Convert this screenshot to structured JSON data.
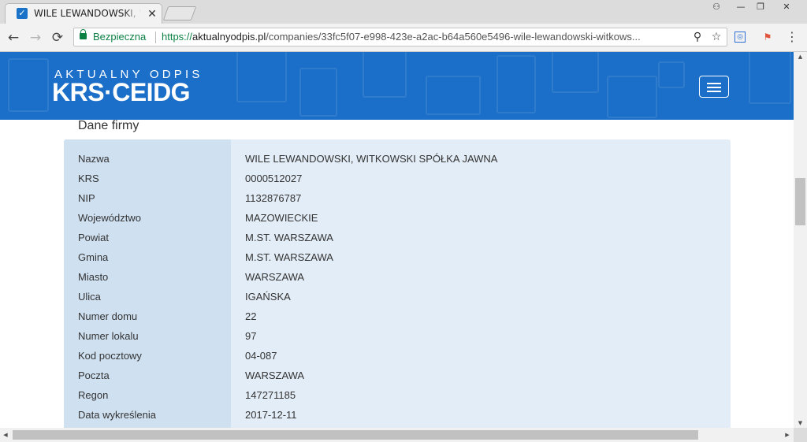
{
  "browser": {
    "tab": {
      "title": "WILE LEWANDOWSKI, WITKOWSKI SPÓŁKA JAWNA",
      "favicon": "check-icon",
      "close_glyph": "✕"
    },
    "window_controls": {
      "profile_glyph": "⚇",
      "minimize_glyph": "—",
      "restore_glyph": "❐",
      "close_glyph": "✕"
    },
    "toolbar": {
      "back_glyph": "←",
      "forward_glyph": "→",
      "reload_glyph": "⟳",
      "secure_label": "Bezpieczna",
      "url_scheme": "https://",
      "url_host": "aktualnyodpis.pl",
      "url_path": "/companies/33fc5f07-e998-423e-a2ac-b64a560e5496-wile-lewandowski-witkows...",
      "zoom_glyph": "⚲",
      "bookmark_glyph": "☆",
      "menu_glyph": "⋮"
    }
  },
  "site": {
    "logo": {
      "line1": "AKTUALNY ODPIS",
      "line2": "KRS·CEIDG"
    },
    "accent_color": "#1b6fc9"
  },
  "company": {
    "section_title": "Dane firmy",
    "rows": [
      {
        "label": "Nazwa",
        "value": "WILE LEWANDOWSKI, WITKOWSKI SPÓŁKA JAWNA"
      },
      {
        "label": "KRS",
        "value": "0000512027"
      },
      {
        "label": "NIP",
        "value": "1132876787"
      },
      {
        "label": "Województwo",
        "value": "MAZOWIECKIE"
      },
      {
        "label": "Powiat",
        "value": "M.ST. WARSZAWA"
      },
      {
        "label": "Gmina",
        "value": "M.ST. WARSZAWA"
      },
      {
        "label": "Miasto",
        "value": "WARSZAWA"
      },
      {
        "label": "Ulica",
        "value": "IGAŃSKA"
      },
      {
        "label": "Numer domu",
        "value": "22"
      },
      {
        "label": "Numer lokalu",
        "value": "97"
      },
      {
        "label": "Kod pocztowy",
        "value": "04-087"
      },
      {
        "label": "Poczta",
        "value": "WARSZAWA"
      },
      {
        "label": "Regon",
        "value": "147271185"
      },
      {
        "label": "Data wykreślenia",
        "value": "2017-12-11"
      }
    ]
  }
}
